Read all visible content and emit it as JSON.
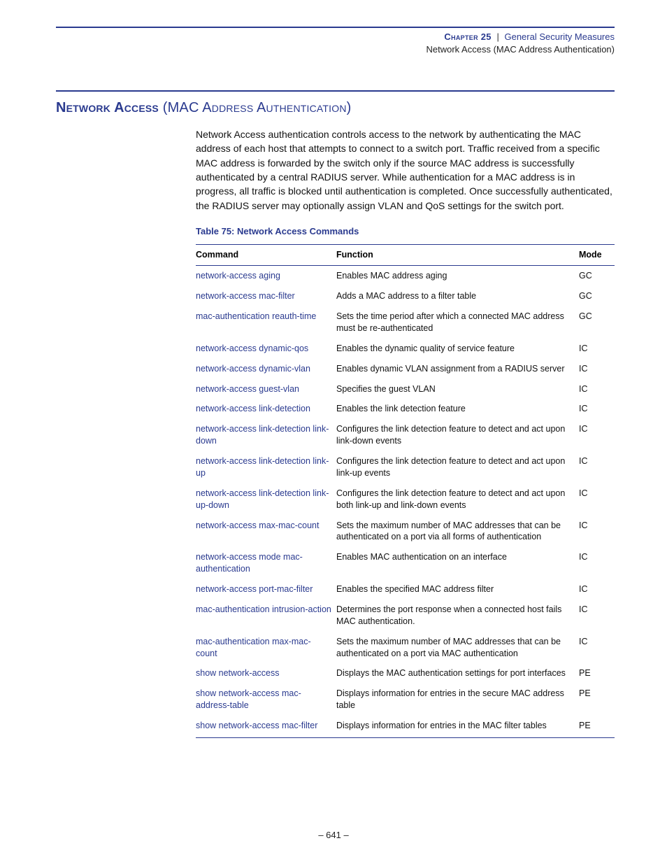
{
  "header": {
    "chapter_label": "Chapter 25",
    "separator": "|",
    "chapter_title": "General Security Measures",
    "subtitle": "Network Access (MAC Address Authentication)"
  },
  "section": {
    "title_lead": "Network Access",
    "title_rest": " (MAC Address Authentication)"
  },
  "intro_text": "Network Access authentication controls access to the network by authenticating the MAC address of each host that attempts to connect to a switch port. Traffic received from a specific MAC address is forwarded by the switch only if the source MAC address is successfully authenticated by a central RADIUS server. While authentication for a MAC address is in progress, all traffic is blocked until authentication is completed. Once successfully authenticated, the RADIUS server may optionally assign VLAN and QoS settings for the switch port.",
  "table_title": "Table 75: Network Access Commands",
  "columns": {
    "c0": "Command",
    "c1": "Function",
    "c2": "Mode"
  },
  "rows": [
    {
      "cmd": "network-access aging",
      "fn": "Enables MAC address aging",
      "mode": "GC"
    },
    {
      "cmd": "network-access mac-filter",
      "fn": "Adds a MAC address to a filter table",
      "mode": "GC"
    },
    {
      "cmd": "mac-authentication reauth-time",
      "fn": "Sets the time period after which a connected MAC address must be re-authenticated",
      "mode": "GC"
    },
    {
      "cmd": "network-access dynamic-qos",
      "fn": "Enables the dynamic quality of service feature",
      "mode": "IC"
    },
    {
      "cmd": "network-access dynamic-vlan",
      "fn": "Enables dynamic VLAN assignment from a RADIUS server",
      "mode": "IC"
    },
    {
      "cmd": "network-access guest-vlan",
      "fn": "Specifies the guest VLAN",
      "mode": "IC"
    },
    {
      "cmd": "network-access link-detection",
      "fn": "Enables the link detection feature",
      "mode": "IC"
    },
    {
      "cmd": "network-access link-detection link-down",
      "fn": "Configures the link detection feature to detect and act upon link-down events",
      "mode": "IC"
    },
    {
      "cmd": "network-access link-detection link-up",
      "fn": "Configures the link detection feature to detect and act upon link-up events",
      "mode": "IC"
    },
    {
      "cmd": "network-access link-detection link-up-down",
      "fn": "Configures the link detection feature to detect and act upon both link-up and link-down events",
      "mode": "IC"
    },
    {
      "cmd": "network-access max-mac-count",
      "fn": "Sets the maximum number of MAC addresses that can be authenticated on a port via all forms of authentication",
      "mode": "IC"
    },
    {
      "cmd": "network-access mode mac-authentication",
      "fn": "Enables MAC authentication on an interface",
      "mode": "IC"
    },
    {
      "cmd": " network-access port-mac-filter",
      "fn": "Enables the specified MAC address filter",
      "mode": "IC"
    },
    {
      "cmd": "mac-authentication intrusion-action",
      "fn": "Determines the port response when a connected host fails MAC authentication.",
      "mode": "IC"
    },
    {
      "cmd": "mac-authentication max-mac-count",
      "fn": "Sets the maximum number of MAC addresses that can be authenticated on a port via MAC authentication",
      "mode": "IC"
    },
    {
      "cmd": "show network-access",
      "fn": "Displays the MAC authentication settings for port interfaces",
      "mode": "PE"
    },
    {
      "cmd": "show network-access mac-address-table",
      "fn": "Displays information for entries in the secure MAC address table",
      "mode": "PE"
    },
    {
      "cmd": "show network-access mac-filter",
      "fn": "Displays information for entries in the MAC filter tables",
      "mode": "PE"
    }
  ],
  "footer": {
    "page_number": "–  641  –"
  }
}
